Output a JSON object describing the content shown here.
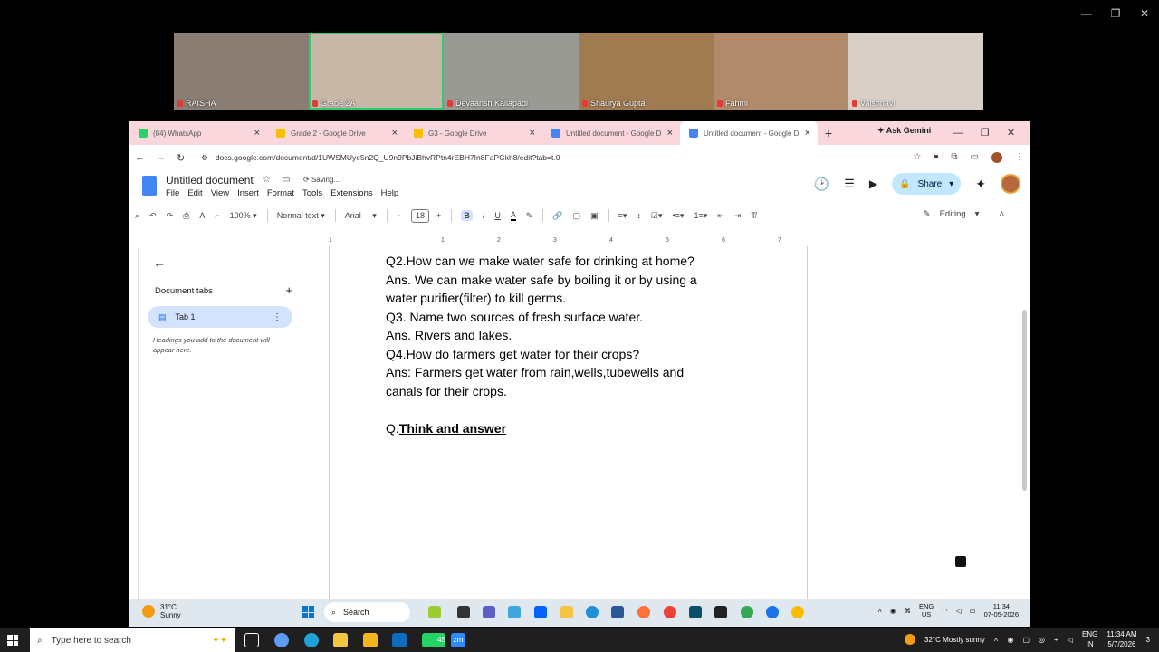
{
  "zoom_window": {
    "minimize": "—",
    "maximize": "❐",
    "close": "✕"
  },
  "participants": [
    {
      "name": "RAISHA",
      "bg": "#8a7d73",
      "active": false
    },
    {
      "name": "Grade 2A",
      "bg": "#c9b8a8",
      "active": true
    },
    {
      "name": "Devaansh Kallapadi",
      "bg": "#9a9a94",
      "active": false
    },
    {
      "name": "Shaurya Gupta",
      "bg": "#a07a50",
      "active": false
    },
    {
      "name": "Fahmi",
      "bg": "#b08a6a",
      "active": false
    },
    {
      "name": "Vaishnavi",
      "bg": "#d8cfc6",
      "active": false
    }
  ],
  "tabs": [
    {
      "label": "(84) WhatsApp",
      "color": "#25d366"
    },
    {
      "label": "Grade 2 - Google Drive",
      "color": "#fbbc04"
    },
    {
      "label": "G3 - Google Drive",
      "color": "#fbbc04"
    },
    {
      "label": "Untitled document - Google D",
      "color": "#4285f4"
    },
    {
      "label": "Untitled document - Google D",
      "color": "#4285f4"
    }
  ],
  "ask_gemini": "Ask Gemini",
  "url": "docs.google.com/document/d/1UWSMUye5n2Q_U9n9PbJiBhvRPtn4rEBH7In8FaPGkh8/edit?tab=t.0",
  "doc": {
    "title": "Untitled document",
    "saving": "Saving...",
    "menu": [
      "File",
      "Edit",
      "View",
      "Insert",
      "Format",
      "Tools",
      "Extensions",
      "Help"
    ],
    "share_label": "Share",
    "zoom": "100%",
    "style": "Normal text",
    "font": "Arial",
    "font_size": "18",
    "mode": "Editing",
    "ruler": [
      "1",
      "1",
      "2",
      "3",
      "4",
      "5",
      "6",
      "7"
    ],
    "lines": [
      "Q2.How can we make water safe for drinking at home?",
      "Ans. We can make water safe by boiling it or by using a",
      "water purifier(filter) to kill germs.",
      "Q3. Name two sources of fresh surface water.",
      "Ans. Rivers and lakes.",
      "Q4.How do farmers get water for their crops?",
      "Ans: Farmers get water from rain,wells,tubewells and",
      "canals for their crops.",
      ""
    ],
    "last_prefix": "Q.",
    "last_heading": "Think and answer"
  },
  "sidebar": {
    "title": "Document tabs",
    "tab": "Tab 1",
    "hint": "Headings you add to the document will appear here."
  },
  "inner_taskbar": {
    "weather_temp": "31°C",
    "weather_desc": "Sunny",
    "search": "Search",
    "lang": "ENG",
    "region": "US",
    "time": "11:34",
    "date": "07-05-2026"
  },
  "taskbar": {
    "search_placeholder": "Type here to search",
    "weather": "32°C  Mostly sunny",
    "lang": "ENG",
    "region": "IN",
    "time": "11:34 AM",
    "date": "5/7/2026",
    "badge": "45",
    "notif": "3"
  }
}
